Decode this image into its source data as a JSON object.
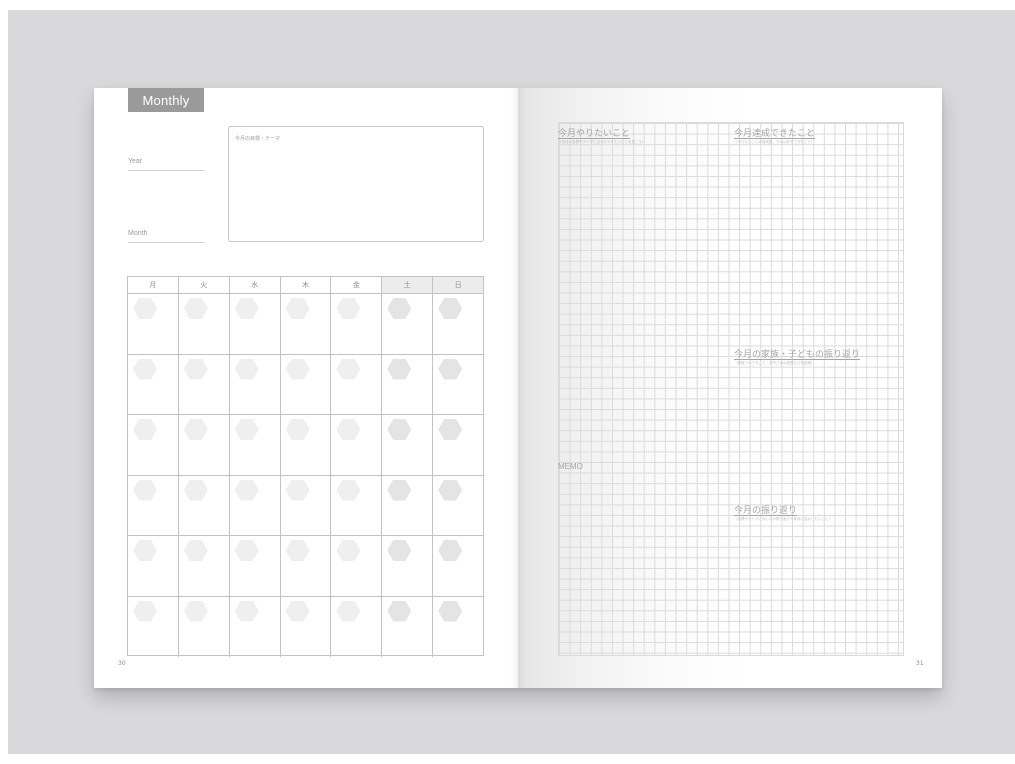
{
  "left_page": {
    "tab_label": "Monthly",
    "year_label": "Year",
    "month_label": "Month",
    "theme_label": "今月の目標・テーマ",
    "weekdays": [
      "月",
      "火",
      "水",
      "木",
      "金",
      "土",
      "日"
    ],
    "page_number": "30"
  },
  "right_page": {
    "sections": [
      {
        "title": "今月やりたいこと",
        "subtitle": "（今月の目標やテーマに沿ったやりたいことを書こう）"
      },
      {
        "title": "今月達成できたこと",
        "subtitle": "（やりたいことの達成度、それ以外でできたこと）"
      },
      {
        "title": "今月の家族・子どもの振り返り",
        "subtitle": "（家族でのできごと・お子さまの成長などを記録）"
      },
      {
        "title": "今月の振り返り",
        "subtitle": "（目標やテーマに対しての振り返りや来月に活かしたいこと）"
      }
    ],
    "memo_label": "MEMO",
    "page_number": "31"
  },
  "colors": {
    "backdrop": "#d9d9dc",
    "tab": "#9a9a9a",
    "grid_line": "#dadada"
  }
}
